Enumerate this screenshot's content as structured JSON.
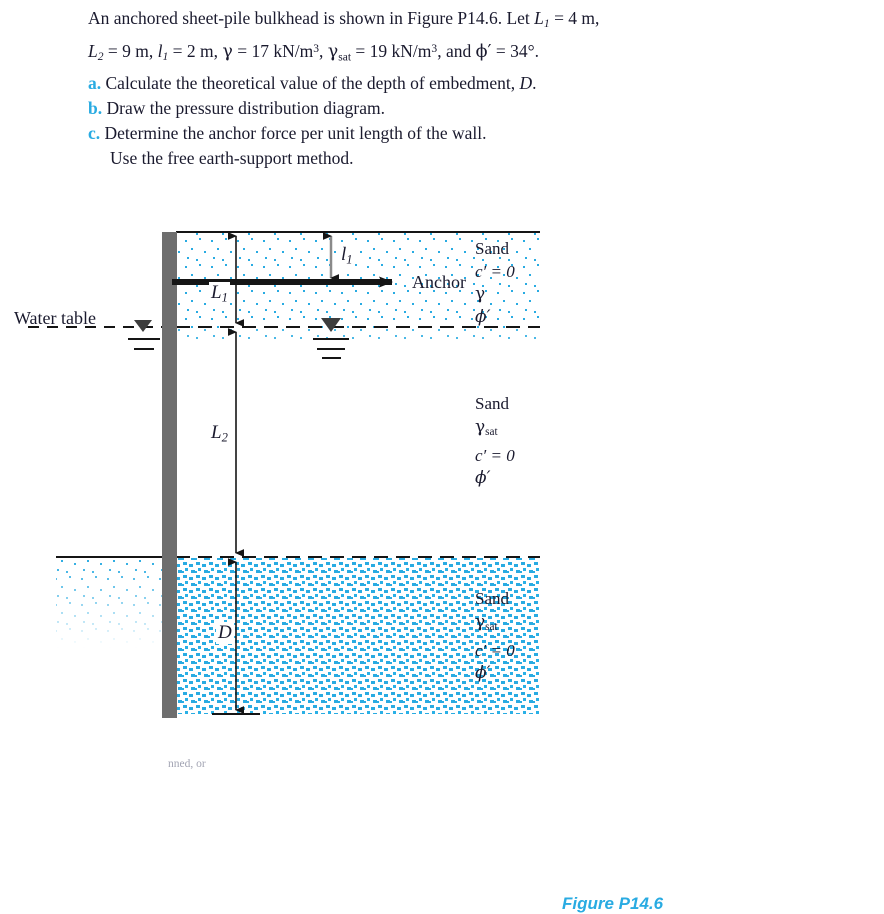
{
  "problem": {
    "intro_line1_a": "An anchored sheet-pile bulkhead is shown in Figure P14.6. Let",
    "intro_L1": "L",
    "intro_L1_sub": "1",
    "intro_L1_val": "= 4 m,",
    "line2_L2": "L",
    "line2_L2_sub": "2",
    "line2_L2_val": "= 9 m,",
    "line2_l1": "l",
    "line2_l1_sub": "1",
    "line2_l1_val": "= 2 m,",
    "line2_gamma": "γ",
    "line2_gamma_val": "= 17 kN/m",
    "line2_gamma_exp": "3",
    "line2_gammasat": "γ",
    "line2_gammasat_sub": "sat",
    "line2_gammasat_val": "= 19 kN/m",
    "line2_gammasat_exp": "3",
    "line2_and": ", and",
    "line2_phi": "ϕ′",
    "line2_phi_val": "= 34°.",
    "items": [
      {
        "marker": "a.",
        "text_pre": "Calculate the theoretical value of the depth of embedment,",
        "sym": "D",
        "text_post": "."
      },
      {
        "marker": "b.",
        "text_pre": "Draw the pressure distribution diagram.",
        "sym": "",
        "text_post": ""
      },
      {
        "marker": "c.",
        "text_pre": "Determine the anchor force per unit length of the wall.",
        "sym": "",
        "text_post": ""
      }
    ],
    "note": "Use the free earth-support method."
  },
  "figure": {
    "caption": "Figure P14.6",
    "water_table_label": "Water table",
    "anchor_label": "Anchor",
    "dim_L1": "L",
    "dim_L1_sub": "1",
    "dim_L2": "L",
    "dim_L2_sub": "2",
    "dim_l1": "l",
    "dim_l1_sub": "1",
    "dim_D": "D",
    "soil_top": {
      "name": "Sand",
      "l2": "c′ = 0",
      "l3": "γ",
      "l4": "ϕ′"
    },
    "soil_mid": {
      "name": "Sand",
      "l2": "γ",
      "l2_sub": "sat",
      "l3": "c′ = 0",
      "l4": "ϕ′"
    },
    "soil_bot": {
      "name": "Sand",
      "l2": "γ",
      "l2_sub": "sat",
      "l3": "c′ = 0",
      "l4": "ϕ′"
    },
    "colors": {
      "accent": "#29abe2",
      "wall": "#6e6e6e",
      "line": "#151515",
      "dim_gray": "#8a8a8a",
      "text": "#1a1a2e"
    }
  },
  "footer_text": "nned, or"
}
